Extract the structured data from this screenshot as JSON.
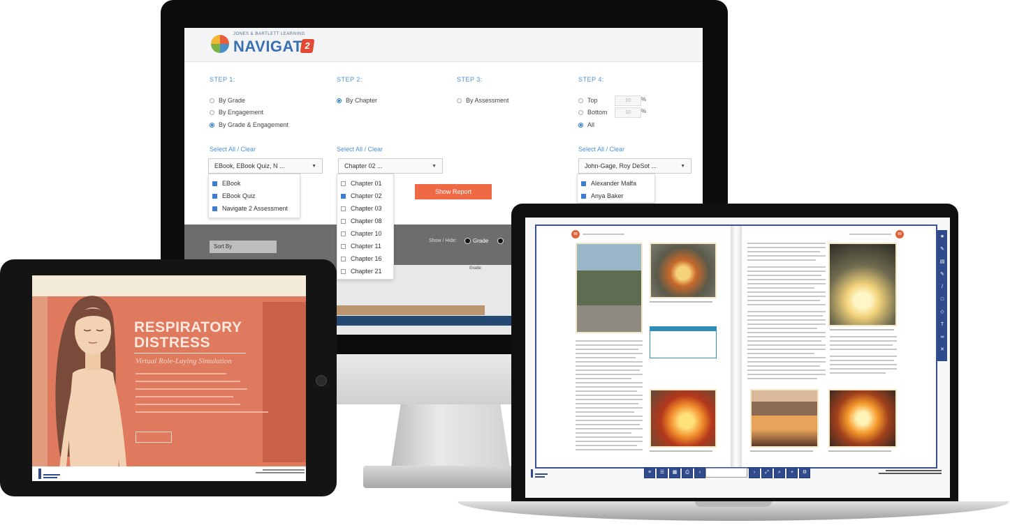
{
  "imac": {
    "logo_small": "JONES & BARTLETT LEARNING",
    "logo_text": "NAVIGATE",
    "logo_badge": "2",
    "steps": [
      {
        "title": "STEP 1:",
        "options": [
          {
            "label": "By Grade",
            "selected": false
          },
          {
            "label": "By Engagement",
            "selected": false
          },
          {
            "label": "By Grade & Engagement",
            "selected": true
          }
        ]
      },
      {
        "title": "STEP 2:",
        "options": [
          {
            "label": "By Chapter",
            "selected": true
          }
        ]
      },
      {
        "title": "STEP 3:",
        "options": [
          {
            "label": "By Assessment",
            "selected": false
          }
        ]
      },
      {
        "title": "STEP 4:",
        "options": [
          {
            "label": "Top",
            "selected": false
          },
          {
            "label": "Bottom",
            "selected": false
          },
          {
            "label": "All",
            "selected": true
          }
        ]
      }
    ],
    "percent_placeholder": "10",
    "percent_symbol": "%",
    "select_all_clear": "Select All / Clear",
    "dropdowns": {
      "assessment_type": "EBook, EBook Quiz, N ...",
      "chapter": "Chapter 02 ...",
      "students": "John-Gage, Roy DeSot ..."
    },
    "assessment_menu": [
      {
        "label": "EBook",
        "checked": true
      },
      {
        "label": "EBook Quiz",
        "checked": true
      },
      {
        "label": "Navigate 2 Assessment",
        "checked": true
      }
    ],
    "chapter_menu": [
      {
        "label": "Chapter 01",
        "checked": false
      },
      {
        "label": "Chapter 02",
        "checked": true
      },
      {
        "label": "Chapter 03",
        "checked": false
      },
      {
        "label": "Chapter 08",
        "checked": false
      },
      {
        "label": "Chapter 10",
        "checked": false
      },
      {
        "label": "Chapter 11",
        "checked": false
      },
      {
        "label": "Chapter 16",
        "checked": false
      },
      {
        "label": "Chapter 21",
        "checked": false
      }
    ],
    "student_menu": [
      {
        "label": "Alexander Malfa",
        "checked": true
      },
      {
        "label": "Anya Baker",
        "checked": true
      }
    ],
    "show_report": "Show Report",
    "sort_by": "Sort By",
    "show_label": "Show / Hide:",
    "grade_toggle": "Grade",
    "grade_axis": "Grade"
  },
  "tablet": {
    "title_line1": "RESPIRATORY",
    "title_line2": "DISTRESS",
    "subtitle": "Virtual Role-Laying Simulation",
    "colors": {
      "coral": "#e07a5f",
      "panel": "#c9604a"
    }
  },
  "laptop": {
    "left_page_number": "88",
    "right_page_number": "89",
    "accent": "#2f4b8c"
  },
  "icons": [
    "apple-logo-icon",
    "navigate-emblem-icon",
    "caret-down-icon",
    "checkbox-icon",
    "radio-icon"
  ]
}
